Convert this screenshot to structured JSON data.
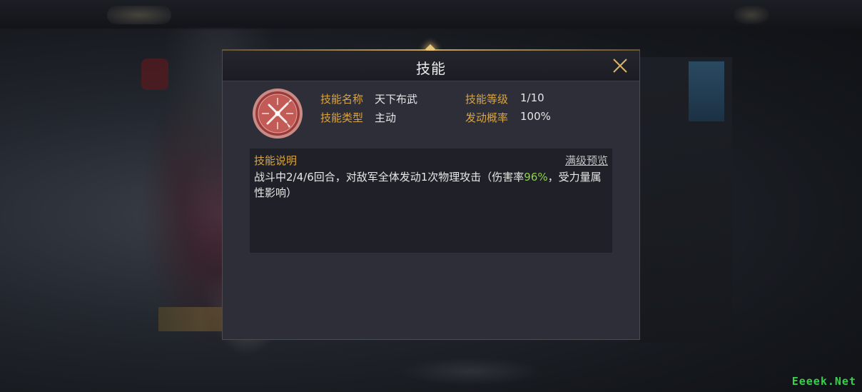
{
  "dialog": {
    "title": "技能",
    "close_icon": "close-icon"
  },
  "skill": {
    "icon": "crossed-swords-icon",
    "name_label": "技能名称",
    "name_value": "天下布武",
    "level_label": "技能等级",
    "level_value": "1/10",
    "type_label": "技能类型",
    "type_value": "主动",
    "chance_label": "发动概率",
    "chance_value": "100%"
  },
  "description": {
    "title": "技能说明",
    "preview_link": "满级预览",
    "text_before": "战斗中2/4/6回合，对敌军全体发动1次物理攻击（伤害率",
    "highlight": "96%",
    "text_after": "，受力量属性影响）"
  },
  "watermark": "Eeeek.Net",
  "colors": {
    "label_gold": "#d9a441",
    "highlight_green": "#8fd04e",
    "panel_bg": "#2d2e37",
    "watermark_green": "#38d04a"
  }
}
